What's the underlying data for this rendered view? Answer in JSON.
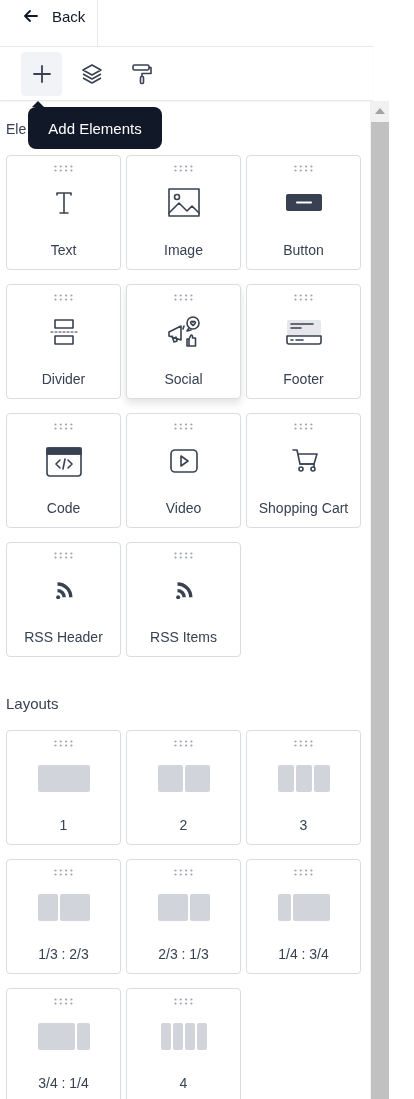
{
  "header": {
    "back_label": "Back"
  },
  "toolbar": [
    {
      "kind": "add",
      "selected": true
    },
    {
      "kind": "layers",
      "selected": false
    },
    {
      "kind": "style",
      "selected": false
    }
  ],
  "tooltip": "Add Elements",
  "elements": {
    "title": "Ele",
    "items": [
      {
        "kind": "text",
        "label": "Text",
        "hovered": false
      },
      {
        "kind": "image",
        "label": "Image",
        "hovered": false
      },
      {
        "kind": "button",
        "label": "Button",
        "hovered": false
      },
      {
        "kind": "divider",
        "label": "Divider",
        "hovered": false
      },
      {
        "kind": "social",
        "label": "Social",
        "hovered": true
      },
      {
        "kind": "footer",
        "label": "Footer",
        "hovered": false
      },
      {
        "kind": "code",
        "label": "Code",
        "hovered": false
      },
      {
        "kind": "video",
        "label": "Video",
        "hovered": false
      },
      {
        "kind": "cart",
        "label": "Shopping Cart",
        "hovered": false
      },
      {
        "kind": "rss",
        "label": "RSS Header",
        "hovered": false
      },
      {
        "kind": "rss",
        "label": "RSS Items",
        "hovered": false
      }
    ]
  },
  "layouts": {
    "title": "Layouts",
    "items": [
      {
        "kind": "one",
        "label": "1"
      },
      {
        "kind": "two",
        "label": "2"
      },
      {
        "kind": "three",
        "label": "3"
      },
      {
        "kind": "third-twothirds",
        "label": "1/3 : 2/3"
      },
      {
        "kind": "twothirds-third",
        "label": "2/3 : 1/3"
      },
      {
        "kind": "quarter-threequarters",
        "label": "1/4 : 3/4"
      },
      {
        "kind": "threequarters-quarter",
        "label": "3/4 : 1/4"
      },
      {
        "kind": "four",
        "label": "4"
      }
    ]
  }
}
